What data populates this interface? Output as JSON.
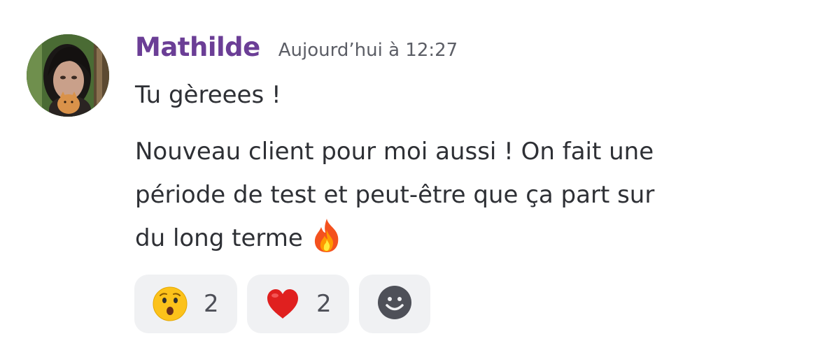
{
  "message": {
    "author": "Mathilde",
    "author_color": "#6b3e96",
    "timestamp": "Aujourd’hui à 12:27",
    "lines": [
      "Tu gèreees !",
      "Nouveau client pour moi aussi ! On fait une",
      "période de test et peut-être que ça part sur",
      "du long terme"
    ],
    "trailing_emoji": "fire-emoji"
  },
  "reactions": [
    {
      "emoji": "astonished-face-emoji",
      "count": "2"
    },
    {
      "emoji": "red-heart-emoji",
      "count": "2"
    }
  ],
  "add_reaction": {
    "icon": "smiley-add-reaction-icon"
  }
}
